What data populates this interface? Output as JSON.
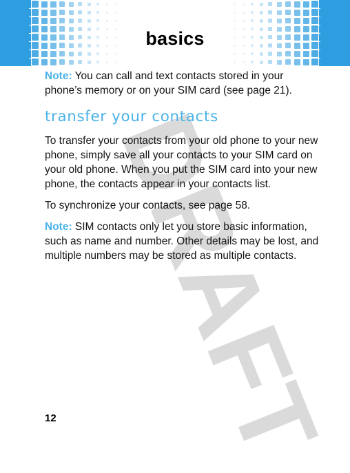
{
  "header": {
    "title": "basics",
    "accent_color": "#2f9ee0"
  },
  "watermark": {
    "text": "DRAFT",
    "color": "#dadada"
  },
  "content": {
    "intro_note": {
      "label": "Note:",
      "text": " You can call and text contacts stored in your phone’s memory or on your SIM card (see page 21)."
    },
    "section_heading": "transfer your contacts",
    "paragraphs": [
      "To transfer your contacts from your old phone to your new phone, simply save all your contacts to your SIM card on your old phone. When you put the SIM card into your new phone, the contacts appear in your contacts list.",
      "To synchronize your contacts, see page 58."
    ],
    "closing_note": {
      "label": "Note:",
      "text": " SIM contacts only let you store basic information, such as name and number. Other details may be lost, and multiple numbers may be stored as multiple contacts."
    },
    "heading_color": "#4ab3e8"
  },
  "footer": {
    "page_number": "12"
  }
}
